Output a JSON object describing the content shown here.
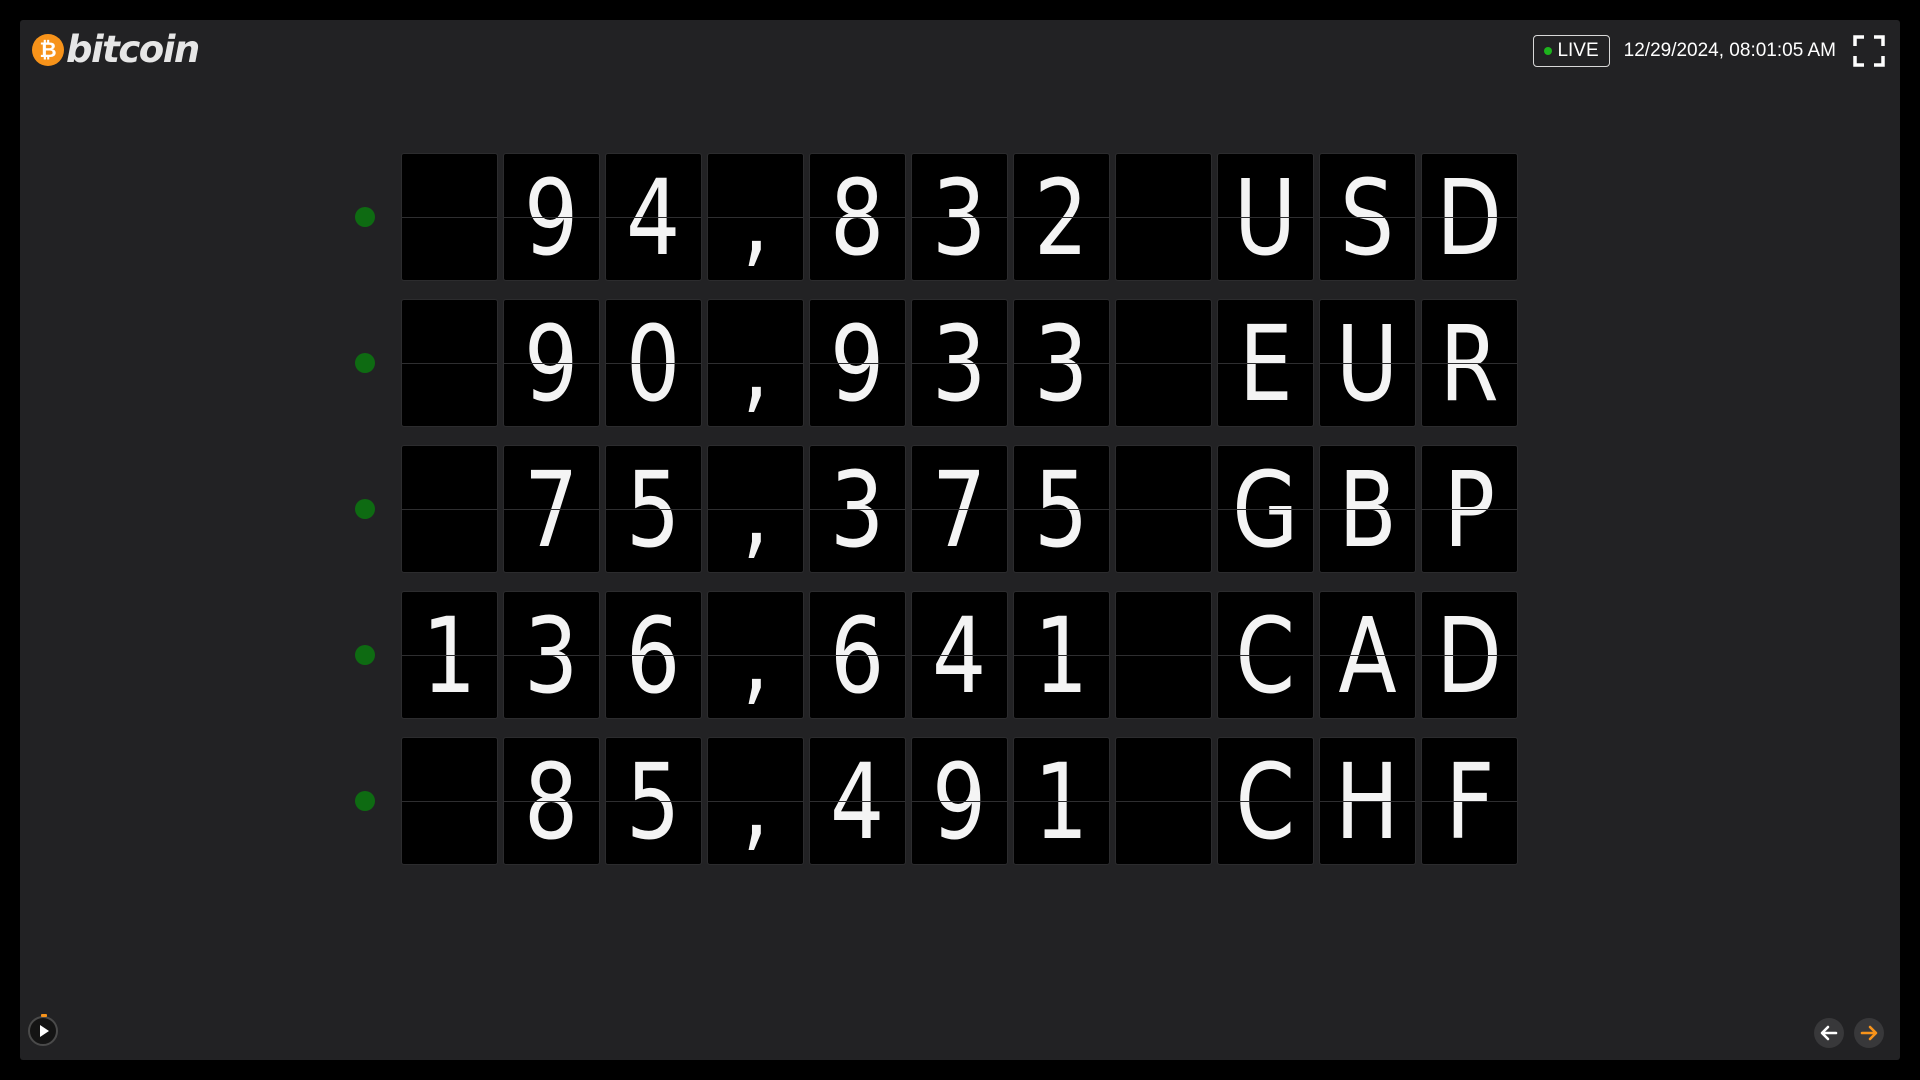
{
  "header": {
    "logo_symbol": "₿",
    "logo_text": "bitcoin",
    "live_label": "LIVE",
    "datetime": "12/29/2024, 08:01:05 AM",
    "icons": {
      "fullscreen": "fullscreen-icon"
    }
  },
  "board": {
    "rows": [
      {
        "status": "up",
        "tiles": [
          " ",
          "9",
          "4",
          ",",
          "8",
          "3",
          "2",
          " ",
          "U",
          "S",
          "D"
        ]
      },
      {
        "status": "up",
        "tiles": [
          " ",
          "9",
          "0",
          ",",
          "9",
          "3",
          "3",
          " ",
          "E",
          "U",
          "R"
        ]
      },
      {
        "status": "up",
        "tiles": [
          " ",
          "7",
          "5",
          ",",
          "3",
          "7",
          "5",
          " ",
          "G",
          "B",
          "P"
        ]
      },
      {
        "status": "up",
        "tiles": [
          "1",
          "3",
          "6",
          ",",
          "6",
          "4",
          "1",
          " ",
          "C",
          "A",
          "D"
        ]
      },
      {
        "status": "up",
        "tiles": [
          " ",
          "8",
          "5",
          ",",
          "4",
          "9",
          "1",
          " ",
          "C",
          "H",
          "F"
        ]
      }
    ]
  },
  "footer": {
    "icons": {
      "play": "play-icon",
      "previous": "arrow-left-icon",
      "next": "arrow-right-icon"
    }
  },
  "colors": {
    "background": "#000000",
    "panel": "#222224",
    "tile": "#000000",
    "tile_text": "#f4f4f4",
    "status_dot": "#0e6b12",
    "live_dot": "#1db31d",
    "brand_orange": "#f7931a"
  }
}
